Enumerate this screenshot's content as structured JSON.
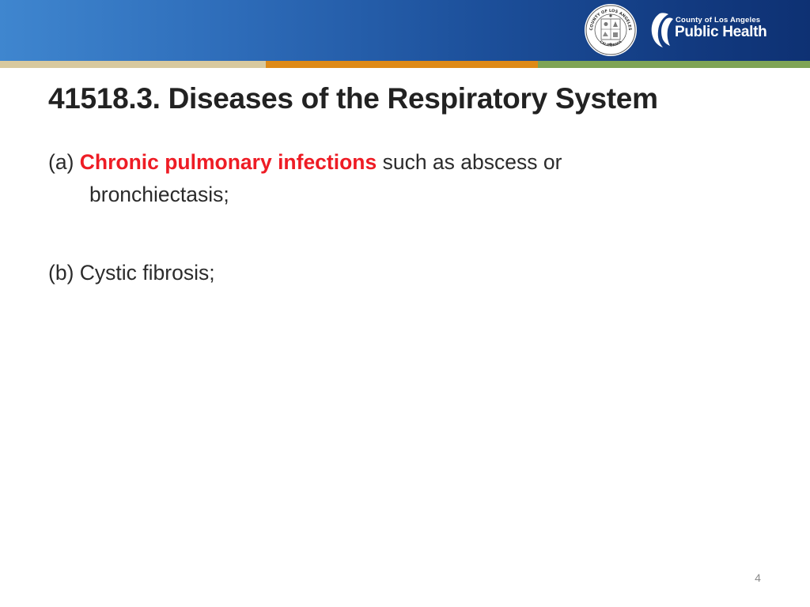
{
  "header": {
    "colors": {
      "band_start": "#3f86cf",
      "band_end": "#0e3173",
      "stripe": [
        "#d8c99e",
        "#de8a17",
        "#7fa455"
      ]
    },
    "seal_text_top": "COUNTY OF LOS ANGELES",
    "seal_text_bottom": "CALIFORNIA",
    "logo": {
      "small_text": "County of Los Angeles",
      "big_text": "Public Health"
    }
  },
  "slide": {
    "title": "41518.3. Diseases of the Respiratory System",
    "items": [
      {
        "label": "(a)",
        "highlight": "Chronic pulmonary infections",
        "text": "such as abscess or bronchiectasis;"
      },
      {
        "label": "(b)",
        "text": "Cystic fibrosis;"
      }
    ],
    "highlight_color": "#ee1c25",
    "page_number": "4"
  }
}
